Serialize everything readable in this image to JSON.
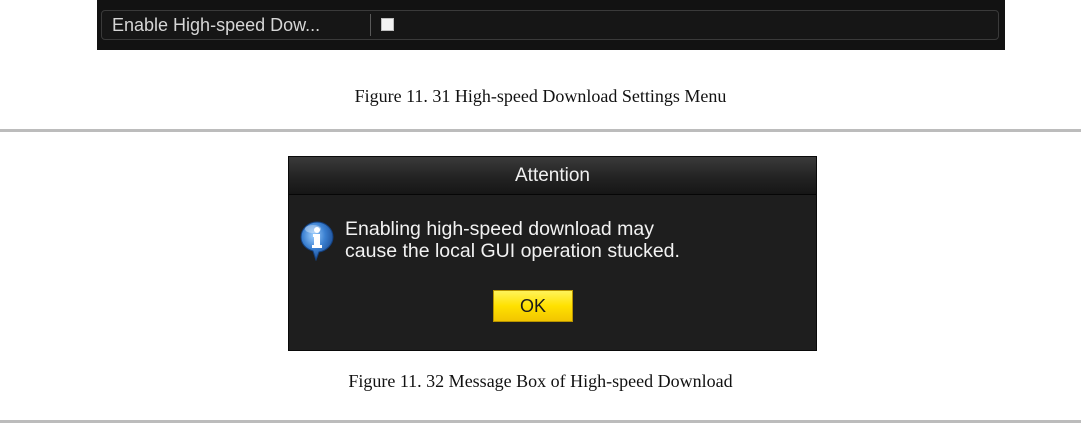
{
  "settings_menu": {
    "label": "Enable High-speed Dow...",
    "checkbox_checked": false
  },
  "captions": {
    "figure_1": "Figure 11. 31 High-speed Download Settings Menu",
    "figure_2": "Figure 11. 32 Message Box of High-speed Download"
  },
  "dialog": {
    "title": "Attention",
    "icon": "info-icon",
    "message_line_1": "Enabling high-speed download may",
    "message_line_2": "cause the local GUI operation stucked.",
    "ok_label": "OK"
  },
  "colors": {
    "panel_background": "#121212",
    "ok_button": "#ffe100",
    "info_icon_blue": "#3a7fd0"
  }
}
